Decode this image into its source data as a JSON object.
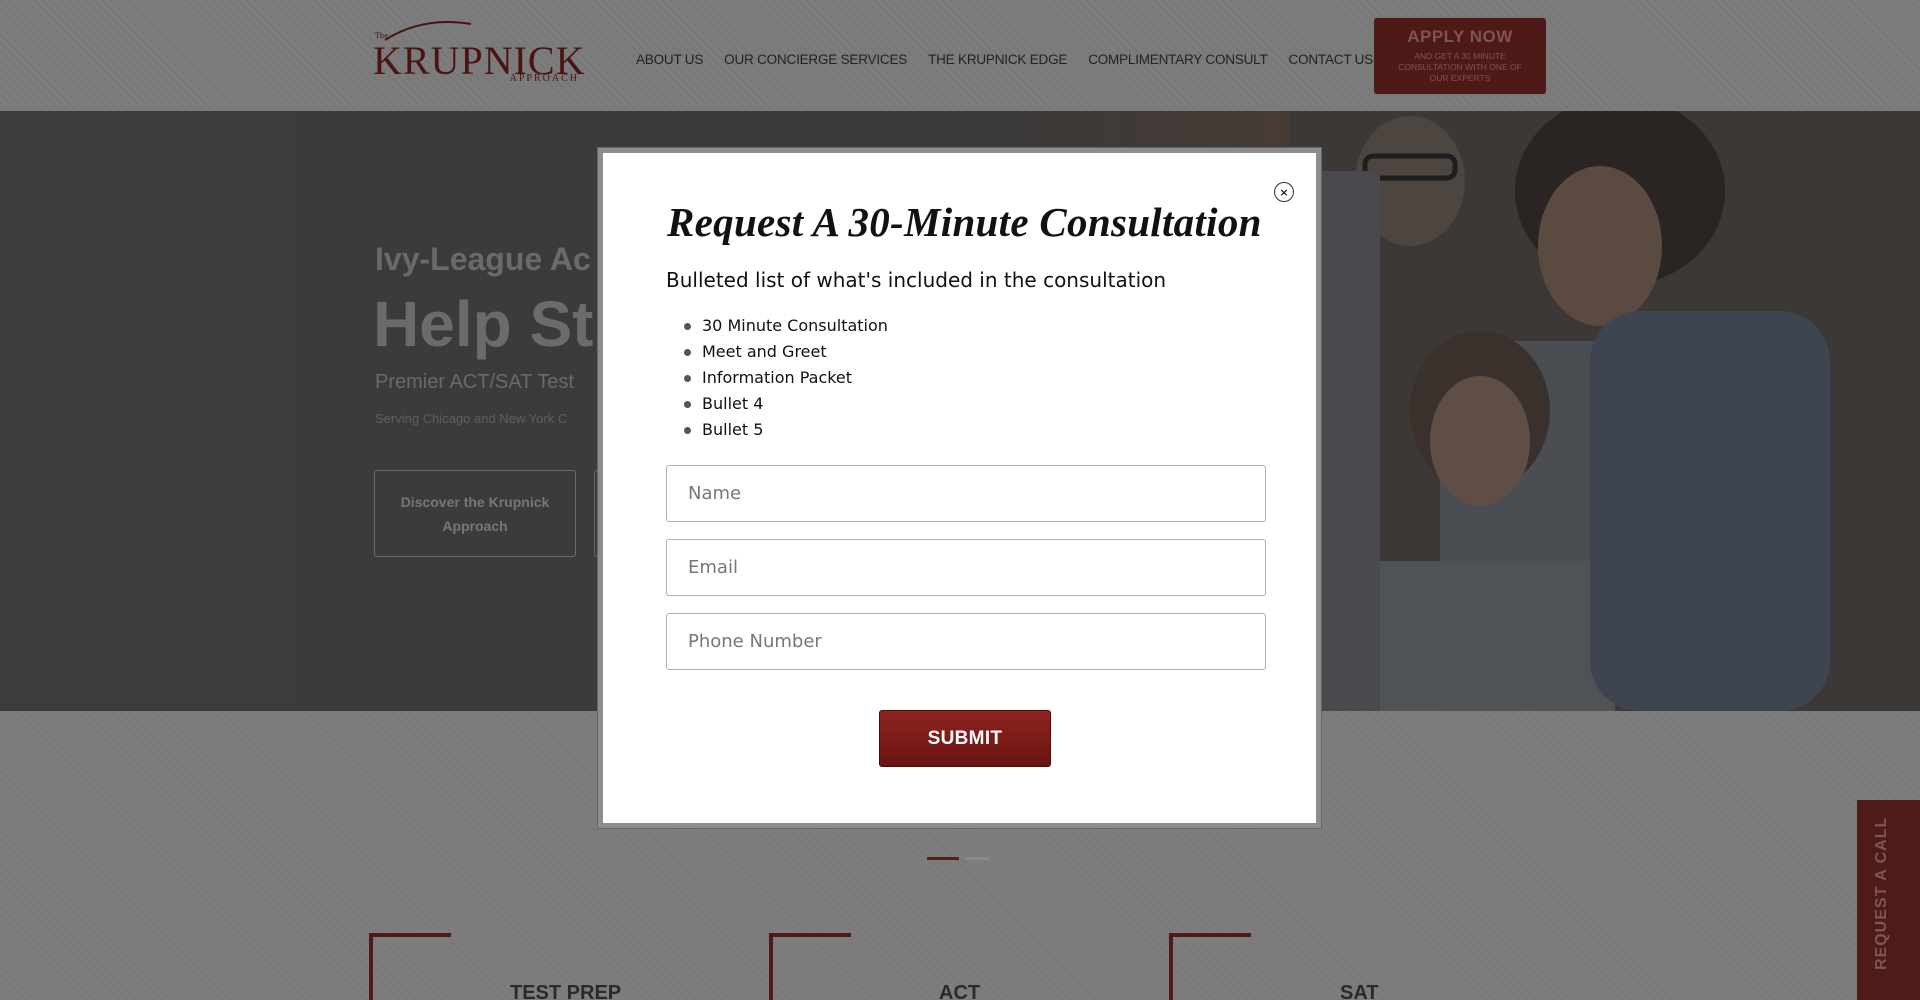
{
  "header": {
    "logo": {
      "the": "The",
      "main": "KRUPNICK",
      "sub": "APPROACH"
    },
    "nav": [
      {
        "label": "ABOUT US"
      },
      {
        "label": "OUR CONCIERGE SERVICES"
      },
      {
        "label": "THE KRUPNICK EDGE"
      },
      {
        "label": "COMPLIMENTARY CONSULT"
      },
      {
        "label": "CONTACT US"
      }
    ],
    "apply": {
      "title": "APPLY NOW",
      "subtitle": "AND GET A 30 MINUTE CONSULTATION WITH ONE OF OUR EXPERTS"
    }
  },
  "hero": {
    "kicker": "Ivy-League Ac",
    "title": "Help St",
    "subtitle": "Premier ACT/SAT Test",
    "small": "Serving Chicago and New York C",
    "button": "Discover the Krupnick Approach"
  },
  "below": {
    "cards": [
      {
        "title": "TEST PREP"
      },
      {
        "title": "ACT"
      },
      {
        "title": "SAT"
      }
    ],
    "call_tab": "REQUEST A CALL"
  },
  "modal": {
    "close_label": "×",
    "title": "Request A 30-Minute Consultation",
    "intro": "Bulleted list of what's included in the consultation",
    "bullets": [
      "30 Minute Consultation",
      "Meet and Greet",
      "Information Packet",
      "Bullet 4",
      "Bullet 5"
    ],
    "fields": {
      "name": {
        "placeholder": "Name",
        "value": ""
      },
      "email": {
        "placeholder": "Email",
        "value": ""
      },
      "phone": {
        "placeholder": "Phone Number",
        "value": ""
      }
    },
    "submit": "SUBMIT"
  },
  "colors": {
    "brand_maroon": "#7a1b18",
    "overlay_gray": "#7a7a7a",
    "modal_border": "#8d8d8d"
  },
  "icons": {
    "close": "close-icon",
    "bullet": "bullet-dot-icon"
  }
}
